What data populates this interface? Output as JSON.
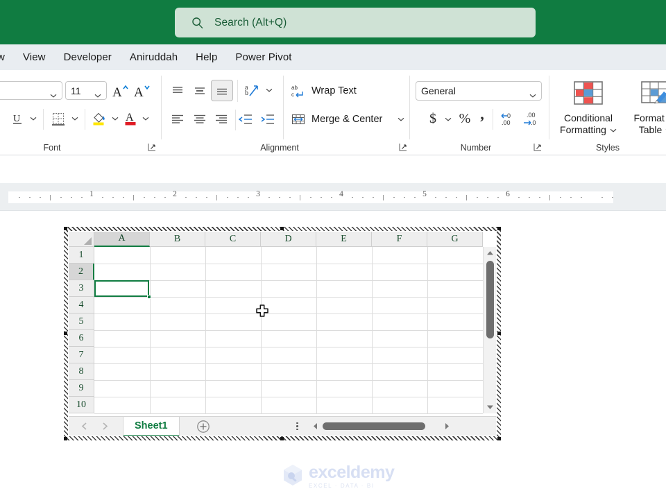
{
  "titlebar": {
    "search": {
      "placeholder": "Search (Alt+Q)",
      "icon": "search-icon"
    },
    "bg_color": "#107c41",
    "search_bg": "#cfe2d5"
  },
  "ribbon_tabs": [
    {
      "label": "w",
      "clipped": true
    },
    {
      "label": "View"
    },
    {
      "label": "Developer"
    },
    {
      "label": "Aniruddah"
    },
    {
      "label": "Help"
    },
    {
      "label": "Power Pivot"
    }
  ],
  "ribbon": {
    "font_group": {
      "label": "Font",
      "font_name": {
        "value": "",
        "icon": "chevron-down-icon"
      },
      "font_size": {
        "value": "11",
        "icon": "chevron-down-icon"
      },
      "grow_font": "A",
      "shrink_font": "A",
      "underline": "U",
      "borders_icon": "borders-icon",
      "fill_color_icon": "fill-color-icon",
      "font_color_icon": "font-color-icon",
      "dialog_launcher": "dialog-launcher-icon"
    },
    "alignment_group": {
      "label": "Alignment",
      "align_top": "align-top-icon",
      "align_middle": "align-middle-icon",
      "align_bottom": "align-bottom-icon",
      "orientation": "orientation-icon",
      "align_left": "align-left-icon",
      "align_center": "align-center-icon",
      "align_right": "align-right-icon",
      "decrease_indent": "decrease-indent-icon",
      "increase_indent": "increase-indent-icon",
      "wrap_text_label": "Wrap Text",
      "merge_center_label": "Merge & Center",
      "dialog_launcher": "dialog-launcher-icon"
    },
    "number_group": {
      "label": "Number",
      "format": {
        "value": "General",
        "icon": "chevron-down-icon"
      },
      "accounting": "$",
      "percent": "%",
      "comma": ",",
      "increase_decimal": "increase-decimal-icon",
      "decrease_decimal": "decrease-decimal-icon",
      "dialog_launcher": "dialog-launcher-icon"
    },
    "styles_group": {
      "label": "Styles",
      "conditional_formatting": "Conditional\nFormatting",
      "conditional_formatting_l1": "Conditional",
      "conditional_formatting_l2": "Formatting",
      "format_as_table_l1": "Format as",
      "format_as_table_l2": "Table"
    }
  },
  "ruler": {
    "numbers": [
      "1",
      "2",
      "3",
      "4",
      "5",
      "6"
    ],
    "left_indent_marker": "indent-marker",
    "right_indent_marker": "right-indent-marker"
  },
  "worksheet": {
    "columns": [
      "A",
      "B",
      "C",
      "D",
      "E",
      "F",
      "G"
    ],
    "rows": [
      "1",
      "2",
      "3",
      "4",
      "5",
      "6",
      "7",
      "8",
      "9",
      "10"
    ],
    "selected_cell": "A2",
    "selected_column": "A",
    "selected_row": "2",
    "cell_values": [
      [
        "",
        "",
        "",
        "",
        "",
        "",
        ""
      ],
      [
        "",
        "",
        "",
        "",
        "",
        "",
        ""
      ],
      [
        "",
        "",
        "",
        "",
        "",
        "",
        ""
      ],
      [
        "",
        "",
        "",
        "",
        "",
        "",
        ""
      ],
      [
        "",
        "",
        "",
        "",
        "",
        "",
        ""
      ],
      [
        "",
        "",
        "",
        "",
        "",
        "",
        ""
      ],
      [
        "",
        "",
        "",
        "",
        "",
        "",
        ""
      ],
      [
        "",
        "",
        "",
        "",
        "",
        "",
        ""
      ],
      [
        "",
        "",
        "",
        "",
        "",
        "",
        ""
      ],
      [
        "",
        "",
        "",
        "",
        "",
        "",
        ""
      ]
    ],
    "sheet_tabs": [
      {
        "label": "Sheet1",
        "active": true
      }
    ],
    "add_sheet_icon": "plus-circle-icon",
    "prev_sheet_icon": "chevron-left-icon",
    "next_sheet_icon": "chevron-right-icon",
    "accent_color": "#107c41",
    "cursor": "excel-plus-cursor"
  },
  "watermark": {
    "main": "exceldemy",
    "sub": "EXCEL · DATA · BI",
    "color": "#d7dff3"
  }
}
